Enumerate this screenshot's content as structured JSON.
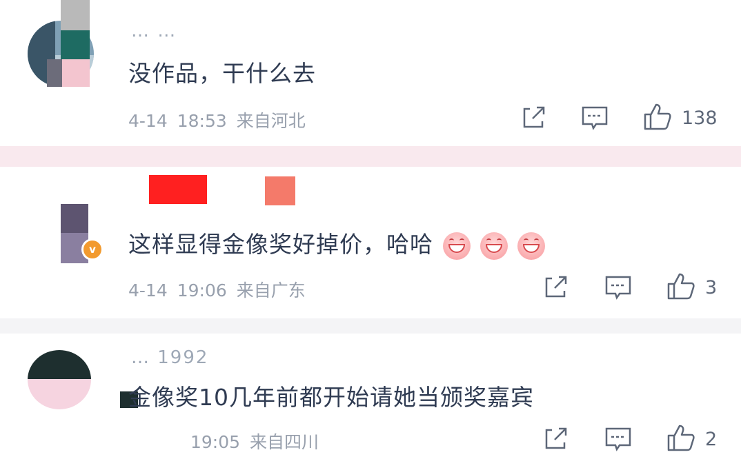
{
  "comments": [
    {
      "username": "… …",
      "text": "没作品，干什么去",
      "date": "4-14",
      "time": "18:53",
      "location": "来自河北",
      "likes": "138"
    },
    {
      "username": "",
      "text": "这样显得金像奖好掉价，哈哈",
      "date": "4-14",
      "time": "19:06",
      "location": "来自广东",
      "likes": "3",
      "emoji_count": 3,
      "verified_badge": "v"
    },
    {
      "username": "… 1992",
      "text": "金像奖10几年前都开始请她当颁奖嘉宾",
      "date": "",
      "time": "19:05",
      "location": "来自四川",
      "likes": "2"
    }
  ],
  "icons": {
    "share": "share-icon",
    "reply": "comment-icon",
    "like": "thumbs-up-icon"
  },
  "colors": {
    "text_primary": "#2f3b52",
    "text_meta": "#98a0ad",
    "divider": "#f9e9ee",
    "badge": "#f29a2e",
    "censor_red": "#ff2020"
  }
}
